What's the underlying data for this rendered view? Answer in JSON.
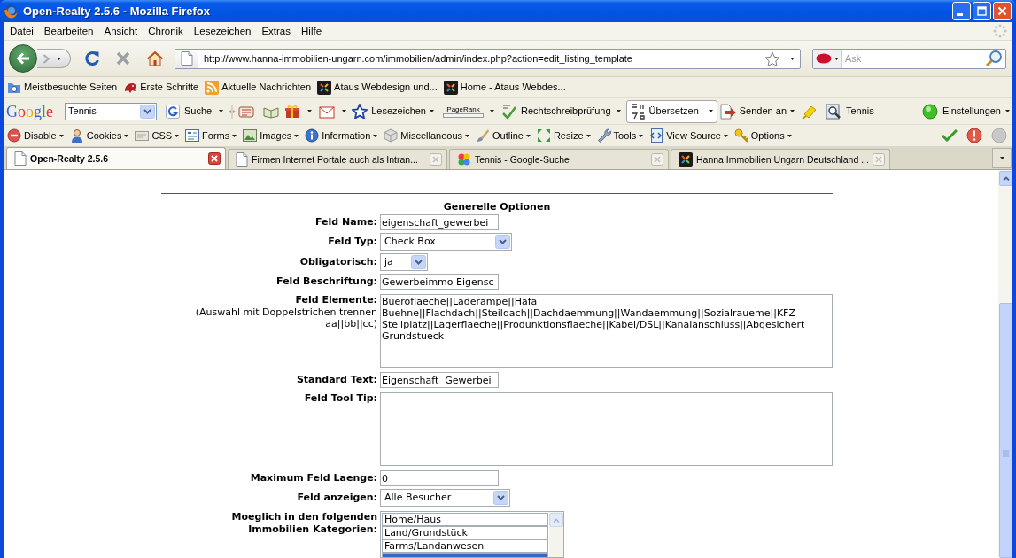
{
  "window": {
    "title": "Open-Realty 2.5.6 - Mozilla Firefox"
  },
  "menu_bar": [
    "Datei",
    "Bearbeiten",
    "Ansicht",
    "Chronik",
    "Lesezeichen",
    "Extras",
    "Hilfe"
  ],
  "navigation": {
    "url": "http://www.hanna-immobilien-ungarn.com/immobilien/admin/index.php?action=edit_listing_template",
    "search": {
      "placeholder": "Ask"
    }
  },
  "bookmarks": [
    "Meistbesuchte Seiten",
    "Erste Schritte",
    "Aktuelle Nachrichten",
    "Ataus Webdesign und...",
    "Home - Ataus Webdes..."
  ],
  "google_toolbar": {
    "logo": "Google",
    "query": "Tennis",
    "search_button": "Suche",
    "bookmarks_button": "Lesezeichen",
    "pagerank": "PageRank",
    "spellcheck_button": "Rechtschreibprüfung",
    "translate_button": "Übersetzen",
    "send_button": "Senden an",
    "highlight_term": "Tennis",
    "settings_button": "Einstellungen"
  },
  "developer_toolbar": [
    "Disable",
    "Cookies",
    "CSS",
    "Forms",
    "Images",
    "Information",
    "Miscellaneous",
    "Outline",
    "Resize",
    "Tools",
    "View Source",
    "Options"
  ],
  "tabs": [
    {
      "title": "Open-Realty 2.5.6",
      "selected": true
    },
    {
      "title": "Firmen Internet Portale auch als Intran...",
      "selected": false
    },
    {
      "title": "Tennis - Google-Suche",
      "selected": false
    },
    {
      "title": "Hanna Immobilien Ungarn Deutschland ...",
      "selected": false
    }
  ],
  "page": {
    "section_title": "Generelle Optionen",
    "fields": [
      {
        "kind": "text",
        "label": "Feld Name:",
        "value": "eigenschaft_gewerbei"
      },
      {
        "kind": "select",
        "label": "Feld Typ:",
        "value": "Check Box"
      },
      {
        "kind": "select",
        "label": "Obligatorisch:",
        "value": "ja"
      },
      {
        "kind": "text",
        "label": "Feld Beschriftung:",
        "value": "Gewerbeimmo Eigensc"
      },
      {
        "kind": "textarea",
        "label": "Feld Elemente:",
        "hint": "(Auswahl mit Doppelstrichen trennen aa||bb||cc)",
        "value": "Bueroflaeche||Laderampe||Hafa\nBuehne||Flachdach||Steildach||Dachdaemmung||Wandaemmung||Sozialraueme||KFZ\nStellplatz||Lagerflaeche||Produnktionsflaeche||Kabel/DSL||Kanalanschluss||Abgesichert\nGrundstueck"
      },
      {
        "kind": "text",
        "label": "Standard Text:",
        "value": "Eigenschaft  Gewerbei"
      },
      {
        "kind": "textarea",
        "label": "Feld Tool Tip:"
      },
      {
        "kind": "text",
        "label": "Maximum Feld Laenge:",
        "value": "0"
      },
      {
        "kind": "select",
        "label": "Feld anzeigen:",
        "value": "Alle Besucher"
      },
      {
        "kind": "listbox",
        "label": "Moeglich in den folgenden Immobilien Kategorien:",
        "options": [
          {
            "label": "Home/Haus",
            "selected": false
          },
          {
            "label": "Land/Grundstück",
            "selected": false
          },
          {
            "label": "Farms/Landanwesen",
            "selected": false
          },
          {
            "selected": true
          }
        ]
      }
    ]
  }
}
